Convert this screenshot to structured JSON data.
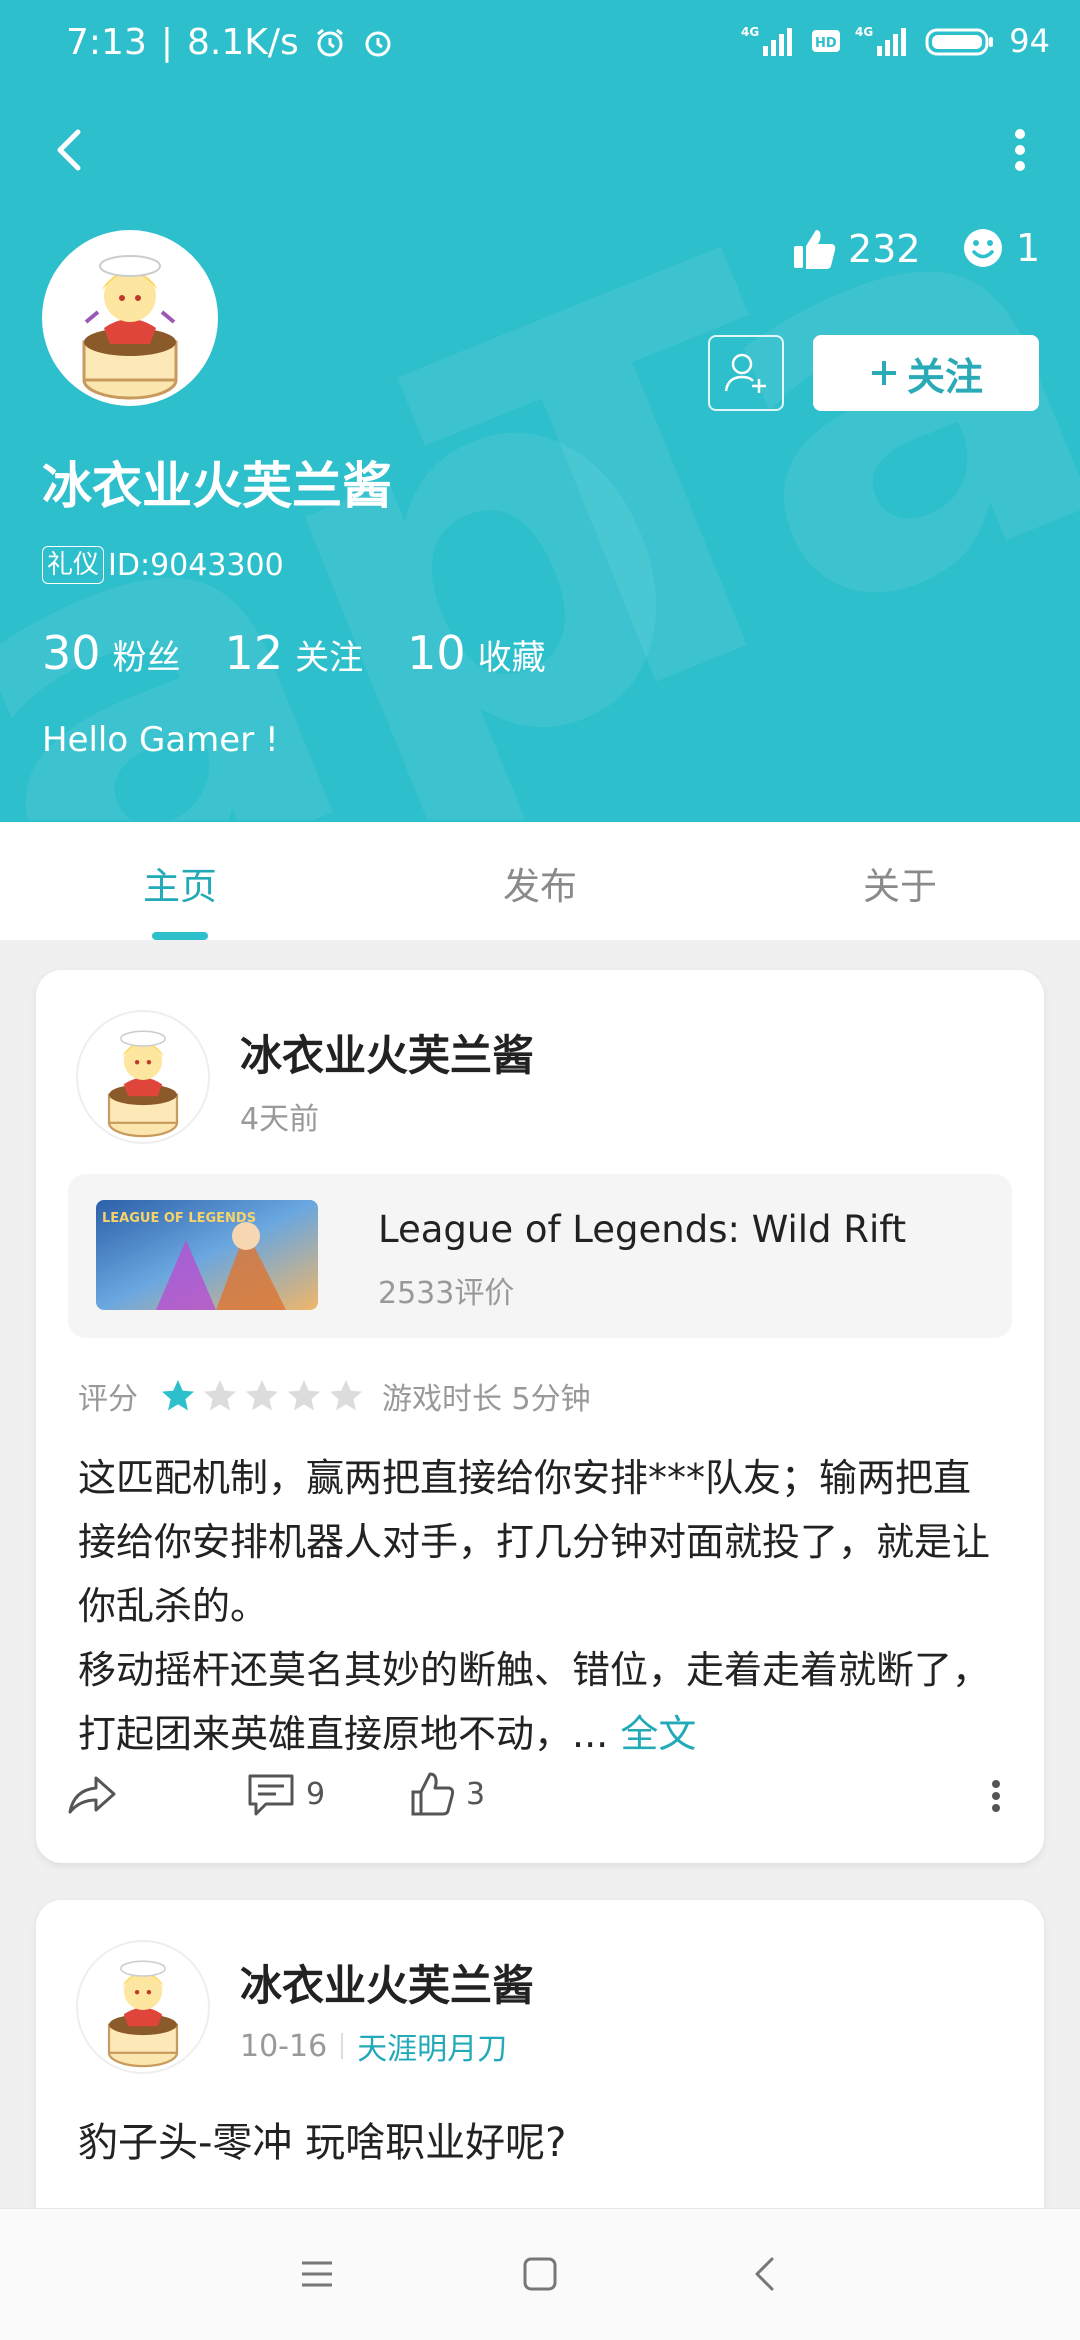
{
  "status_bar": {
    "time": "7:13",
    "speed": "8.1K/s",
    "battery": "94"
  },
  "profile": {
    "name": "冰衣业火芙兰酱",
    "badge": "礼仪",
    "id_text": "ID:9043300",
    "likes": "232",
    "smiles": "1",
    "follow_label": "关注",
    "fans_count": "30",
    "fans_label": "粉丝",
    "following_count": "12",
    "following_label": "关注",
    "favorites_count": "10",
    "favorites_label": "收藏",
    "bio": "Hello Gamer !"
  },
  "tabs": [
    {
      "label": "主页",
      "active": true
    },
    {
      "label": "发布",
      "active": false
    },
    {
      "label": "关于",
      "active": false
    }
  ],
  "posts": [
    {
      "author": "冰衣业火芙兰酱",
      "time": "4天前",
      "game": {
        "title": "League of Legends: Wild Rift",
        "reviews": "2533评价",
        "thumb_text": "LEAGUE OF LEGENDS"
      },
      "rating_label": "评分",
      "rating": 1,
      "rating_max": 5,
      "playtime": "游戏时长 5分钟",
      "text": "这匹配机制，赢两把直接给你安排***队友；输两把直接给你安排机器人对手，打几分钟对面就投了，就是让你乱杀的。\n移动摇杆还莫名其妙的断触、错位，走着走着就断了，打起团来英雄直接原地不动，... ",
      "more_label": "全文",
      "comments": "9",
      "likes": "3"
    },
    {
      "author": "冰衣业火芙兰酱",
      "time": "10-16",
      "tag": "天涯明月刀",
      "text": "豹子头-零冲 玩啥职业好呢?"
    }
  ],
  "colors": {
    "accent": "#2ebfcc",
    "accent_text": "#23aab8",
    "star_on": "#2ebfcc",
    "star_off": "#dcdcdc"
  }
}
